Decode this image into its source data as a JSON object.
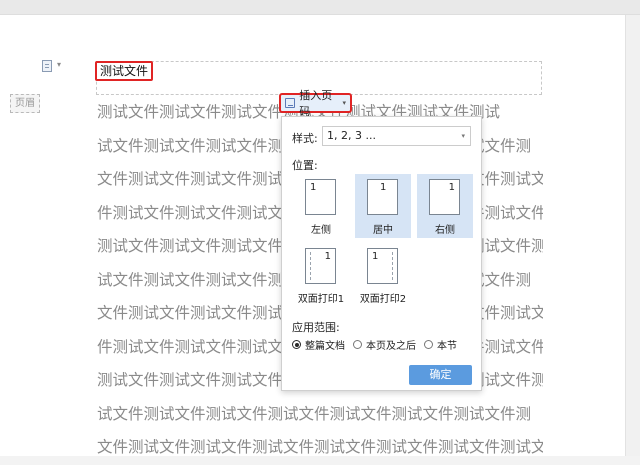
{
  "header": {
    "text": "测试文件",
    "label": "页眉",
    "icon": "header-doc-icon",
    "caret": "▾"
  },
  "body": {
    "lines": [
      "测试文件测试文件测试文件测试文件测试文件测试文件测试",
      "试文件测试文件测试文件测试文件测试文件测试文件测试文件测",
      "文件测试文件测试文件测试文件测试文件测试文件测试文件测试文",
      "件测试文件测试文件测试文件测试文件测试文件测试文件测试文件",
      "测试文件测试文件测试文件测试文件测试文件测试文件测试文件测试",
      "试文件测试文件测试文件测试文件测试文件测试文件测试文件测",
      "文件测试文件测试文件测试文件测试文件测试文件测试文件测试文",
      "件测试文件测试文件测试文件测试文件测试文件测试文件测试文件",
      "测试文件测试文件测试文件测试文件测试文件测试文件测试文件测试",
      "试文件测试文件测试文件测试文件测试文件测试文件测试文件测",
      "文件测试文件测试文件测试文件测试文件测试文件测试文件测试文"
    ]
  },
  "insert_button": {
    "label": "插入页码",
    "caret": "▾",
    "icon": "page-number-icon"
  },
  "panel": {
    "style_label": "样式:",
    "style_value": "1, 2, 3 ...",
    "style_caret": "▾",
    "position_label": "位置:",
    "positions": [
      {
        "label": "左侧",
        "num": "1",
        "selected": false
      },
      {
        "label": "居中",
        "num": "1",
        "selected": true
      },
      {
        "label": "右侧",
        "num": "1",
        "selected": true
      },
      {
        "label": "双面打印1",
        "num": "1",
        "selected": false
      },
      {
        "label": "双面打印2",
        "num": "1",
        "selected": false
      }
    ],
    "range_label": "应用范围:",
    "range_options": [
      {
        "label": "整篇文档",
        "checked": true
      },
      {
        "label": "本页及之后",
        "checked": false
      },
      {
        "label": "本节",
        "checked": false
      }
    ],
    "ok_label": "确定"
  },
  "colors": {
    "accent": "#5b9bdf",
    "highlight_border": "#e02424",
    "selected_bg": "#d6e4f5",
    "body_text": "#8a8a8a"
  }
}
